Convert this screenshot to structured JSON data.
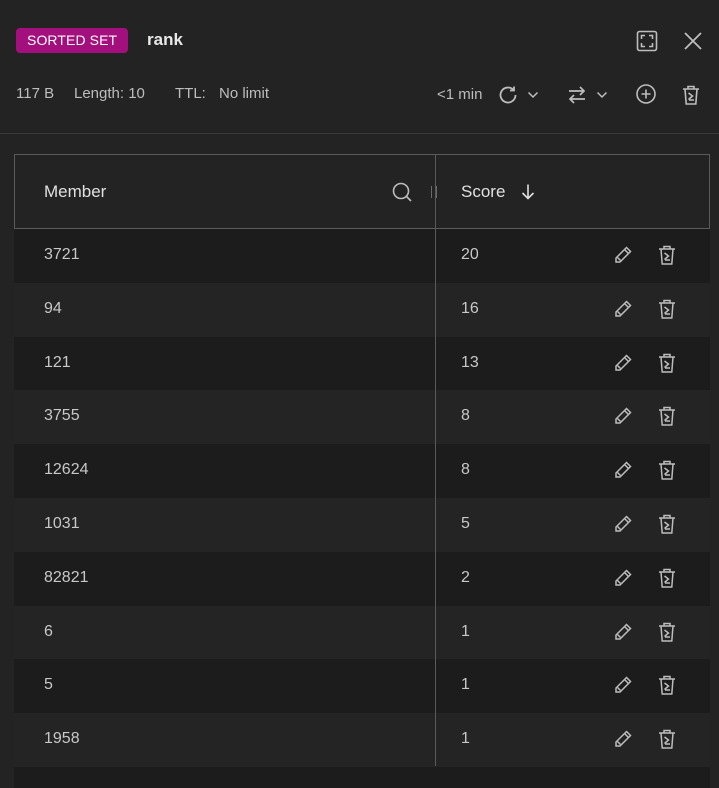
{
  "header": {
    "type_badge": "SORTED SET",
    "key_name": "rank",
    "size": "117 B",
    "length": "Length: 10",
    "ttl_label": "TTL:",
    "ttl_value": "No limit",
    "refresh_age": "<1 min"
  },
  "table": {
    "columns": {
      "member": "Member",
      "score": "Score"
    },
    "sort": "score-desc",
    "rows": [
      {
        "member": "3721",
        "score": "20"
      },
      {
        "member": "94",
        "score": "16"
      },
      {
        "member": "121",
        "score": "13"
      },
      {
        "member": "3755",
        "score": "8"
      },
      {
        "member": "12624",
        "score": "8"
      },
      {
        "member": "1031",
        "score": "5"
      },
      {
        "member": "82821",
        "score": "2"
      },
      {
        "member": "6",
        "score": "1"
      },
      {
        "member": "5",
        "score": "1"
      },
      {
        "member": "1958",
        "score": "1"
      }
    ]
  },
  "colors": {
    "badge": "#a3107e",
    "background": "#232323",
    "row_alt": "#242424",
    "row": "#1c1c1c"
  },
  "icons": [
    "fullscreen-icon",
    "close-icon",
    "refresh-icon",
    "chevron-down-icon",
    "swap-icon",
    "add-circle-icon",
    "trash-icon",
    "search-icon",
    "arrow-down-icon",
    "pencil-icon"
  ]
}
